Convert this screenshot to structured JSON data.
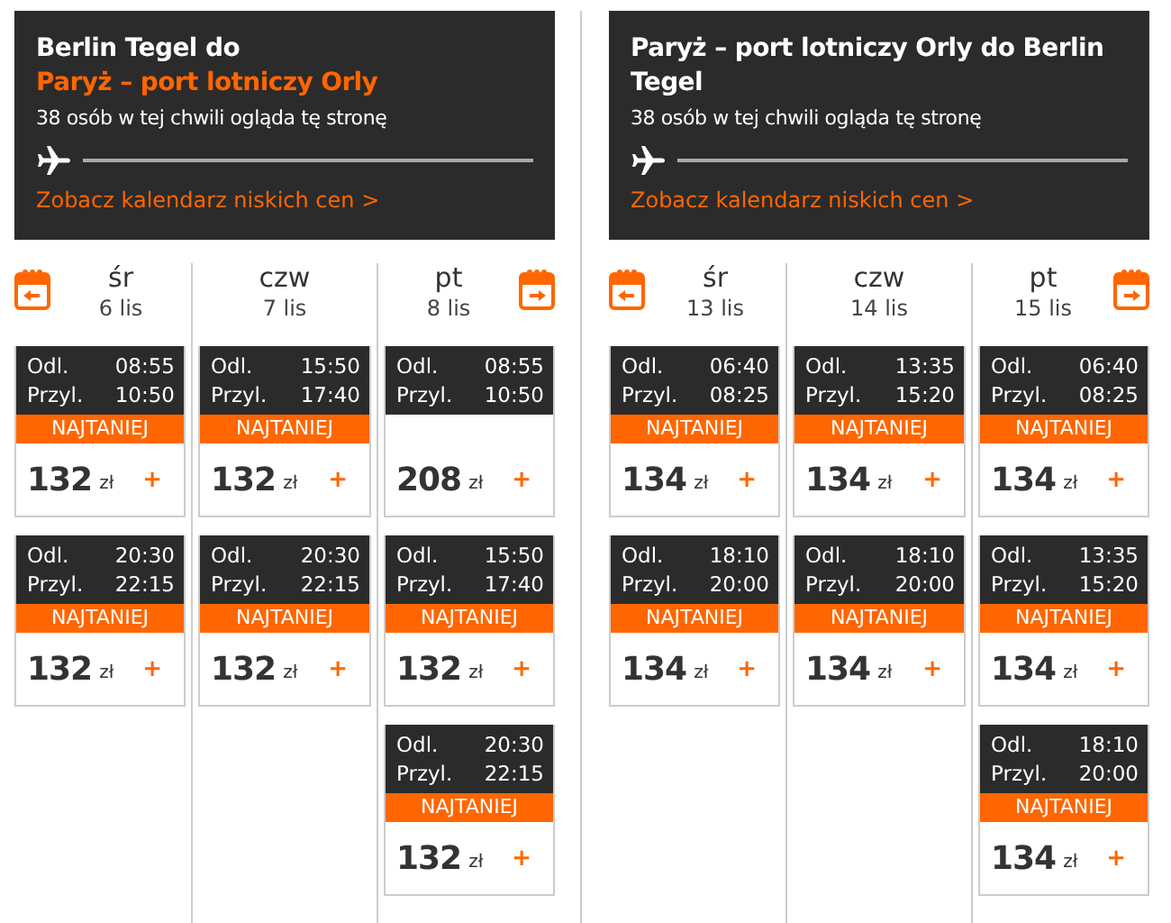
{
  "routes": [
    {
      "title": "Berlin Tegel do",
      "destination": "Paryż – port lotniczy Orly",
      "viewers": "38 osób w tej chwili ogląda tę stronę",
      "calendar_link": "Zobacz kalendarz niskich cen >",
      "days": [
        {
          "weekday": "śr",
          "date": "6 lis",
          "flights": [
            {
              "depart_label": "Odl.",
              "depart": "08:55",
              "arrive_label": "Przyl.",
              "arrive": "10:50",
              "badge": "NAJTANIEJ",
              "price": "132",
              "currency": "zł",
              "add": "+"
            },
            {
              "depart_label": "Odl.",
              "depart": "20:30",
              "arrive_label": "Przyl.",
              "arrive": "22:15",
              "badge": "NAJTANIEJ",
              "price": "132",
              "currency": "zł",
              "add": "+"
            }
          ]
        },
        {
          "weekday": "czw",
          "date": "7 lis",
          "flights": [
            {
              "depart_label": "Odl.",
              "depart": "15:50",
              "arrive_label": "Przyl.",
              "arrive": "17:40",
              "badge": "NAJTANIEJ",
              "price": "132",
              "currency": "zł",
              "add": "+"
            },
            {
              "depart_label": "Odl.",
              "depart": "20:30",
              "arrive_label": "Przyl.",
              "arrive": "22:15",
              "badge": "NAJTANIEJ",
              "price": "132",
              "currency": "zł",
              "add": "+"
            }
          ]
        },
        {
          "weekday": "pt",
          "date": "8 lis",
          "flights": [
            {
              "depart_label": "Odl.",
              "depart": "08:55",
              "arrive_label": "Przyl.",
              "arrive": "10:50",
              "price": "208",
              "currency": "zł",
              "add": "+"
            },
            {
              "depart_label": "Odl.",
              "depart": "15:50",
              "arrive_label": "Przyl.",
              "arrive": "17:40",
              "badge": "NAJTANIEJ",
              "price": "132",
              "currency": "zł",
              "add": "+"
            },
            {
              "depart_label": "Odl.",
              "depart": "20:30",
              "arrive_label": "Przyl.",
              "arrive": "22:15",
              "badge": "NAJTANIEJ",
              "price": "132",
              "currency": "zł",
              "add": "+"
            }
          ]
        }
      ]
    },
    {
      "title": "Paryż – port lotniczy Orly do Berlin Tegel",
      "viewers": "38 osób w tej chwili ogląda tę stronę",
      "calendar_link": "Zobacz kalendarz niskich cen >",
      "days": [
        {
          "weekday": "śr",
          "date": "13 lis",
          "flights": [
            {
              "depart_label": "Odl.",
              "depart": "06:40",
              "arrive_label": "Przyl.",
              "arrive": "08:25",
              "badge": "NAJTANIEJ",
              "price": "134",
              "currency": "zł",
              "add": "+"
            },
            {
              "depart_label": "Odl.",
              "depart": "18:10",
              "arrive_label": "Przyl.",
              "arrive": "20:00",
              "badge": "NAJTANIEJ",
              "price": "134",
              "currency": "zł",
              "add": "+"
            }
          ]
        },
        {
          "weekday": "czw",
          "date": "14 lis",
          "flights": [
            {
              "depart_label": "Odl.",
              "depart": "13:35",
              "arrive_label": "Przyl.",
              "arrive": "15:20",
              "badge": "NAJTANIEJ",
              "price": "134",
              "currency": "zł",
              "add": "+"
            },
            {
              "depart_label": "Odl.",
              "depart": "18:10",
              "arrive_label": "Przyl.",
              "arrive": "20:00",
              "badge": "NAJTANIEJ",
              "price": "134",
              "currency": "zł",
              "add": "+"
            }
          ]
        },
        {
          "weekday": "pt",
          "date": "15 lis",
          "flights": [
            {
              "depart_label": "Odl.",
              "depart": "06:40",
              "arrive_label": "Przyl.",
              "arrive": "08:25",
              "badge": "NAJTANIEJ",
              "price": "134",
              "currency": "zł",
              "add": "+"
            },
            {
              "depart_label": "Odl.",
              "depart": "13:35",
              "arrive_label": "Przyl.",
              "arrive": "15:20",
              "badge": "NAJTANIEJ",
              "price": "134",
              "currency": "zł",
              "add": "+"
            },
            {
              "depart_label": "Odl.",
              "depart": "18:10",
              "arrive_label": "Przyl.",
              "arrive": "20:00",
              "badge": "NAJTANIEJ",
              "price": "134",
              "currency": "zł",
              "add": "+"
            }
          ]
        }
      ]
    }
  ]
}
